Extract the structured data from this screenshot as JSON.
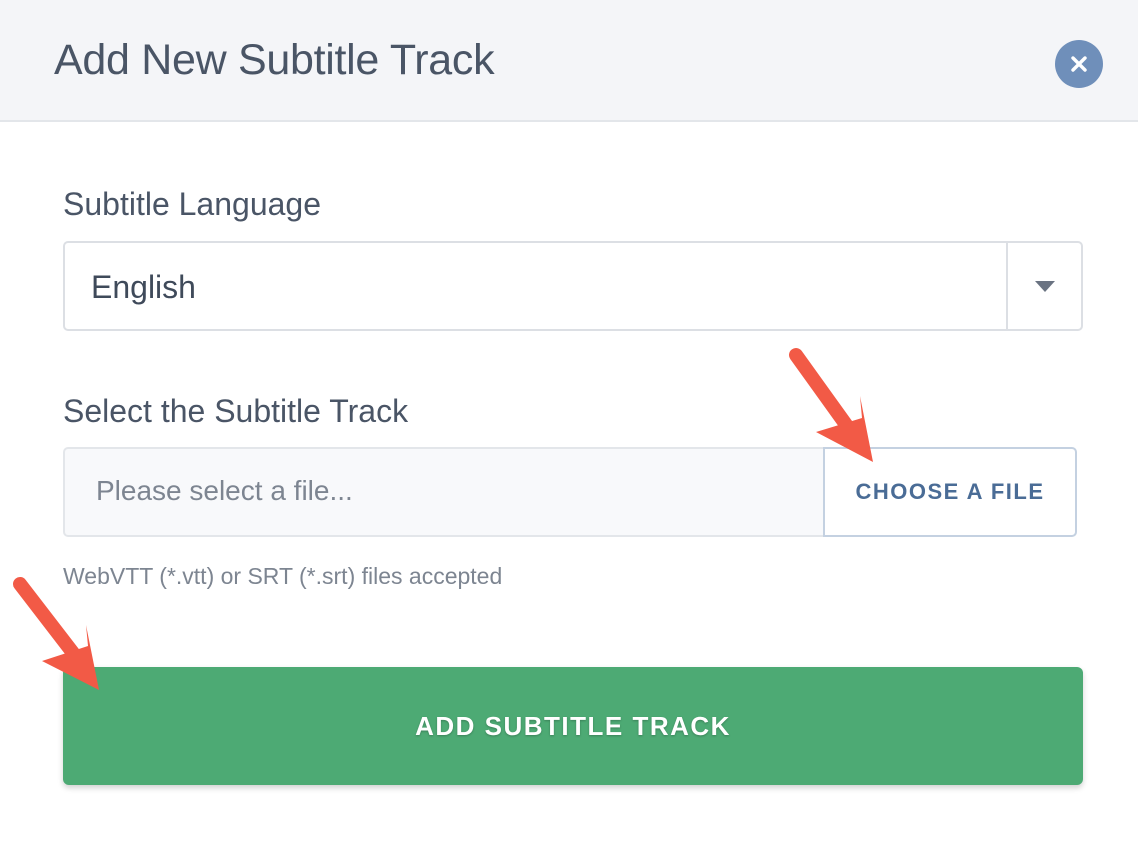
{
  "dialog": {
    "title": "Add New Subtitle Track",
    "close_icon": "close-icon"
  },
  "language_field": {
    "label": "Subtitle Language",
    "selected_value": "English",
    "dropdown_icon": "caret-down-icon"
  },
  "file_field": {
    "label": "Select the Subtitle Track",
    "placeholder": "Please select a file...",
    "choose_button_label": "CHOOSE A FILE",
    "help_text": "WebVTT (*.vtt) or SRT (*.srt) files accepted"
  },
  "submit": {
    "label": "ADD SUBTITLE TRACK"
  },
  "annotations": {
    "arrow_color": "#f25a46",
    "arrow_icon": "annotation-arrow-icon"
  },
  "colors": {
    "header_bg": "#f4f5f8",
    "close_button_bg": "#6f8fba",
    "primary_green": "#4daa74",
    "choose_button_text": "#4a6c96"
  }
}
